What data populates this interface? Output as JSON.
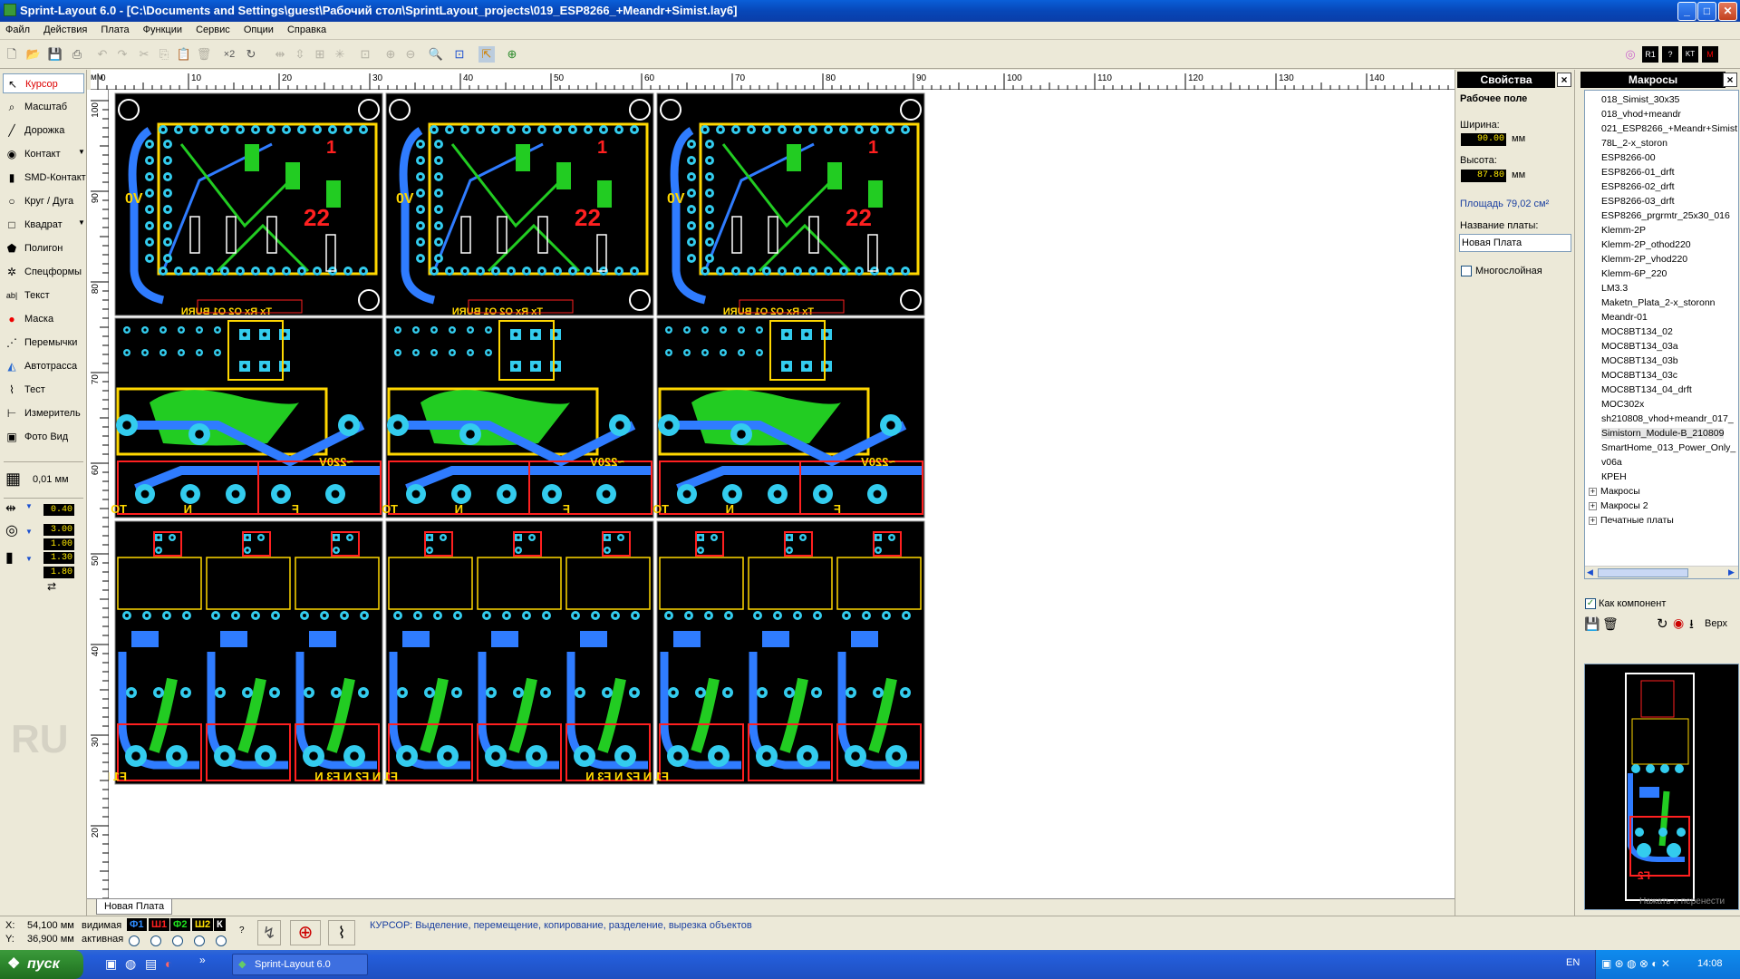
{
  "window": {
    "title": "Sprint-Layout 6.0 - [C:\\Documents and Settings\\guest\\Рабочий стол\\SprintLayout_projects\\019_ESP8266_+Meandr+Simist.lay6]",
    "minimize": "_",
    "maximize": "□",
    "close": "✕"
  },
  "menu": [
    "Файл",
    "Действия",
    "Плата",
    "Функции",
    "Сервис",
    "Опции",
    "Справка"
  ],
  "tools": [
    {
      "label": "Курсор",
      "icon": "cursor-icon",
      "glyph": "↖"
    },
    {
      "label": "Масштаб",
      "icon": "zoom-icon",
      "glyph": "⌕"
    },
    {
      "label": "Дорожка",
      "icon": "track-icon",
      "glyph": "╱"
    },
    {
      "label": "Контакт",
      "icon": "pad-icon",
      "glyph": "◉"
    },
    {
      "label": "SMD-Контакт",
      "icon": "smd-pad-icon",
      "glyph": "▮"
    },
    {
      "label": "Круг / Дуга",
      "icon": "circle-icon",
      "glyph": "○"
    },
    {
      "label": "Квадрат",
      "icon": "square-icon",
      "glyph": "□"
    },
    {
      "label": "Полигон",
      "icon": "polygon-icon",
      "glyph": "⬟"
    },
    {
      "label": "Спецформы",
      "icon": "special-forms-icon",
      "glyph": "✲"
    },
    {
      "label": "Текст",
      "icon": "text-icon",
      "glyph": "ab|"
    },
    {
      "label": "Маска",
      "icon": "mask-icon",
      "glyph": "●"
    },
    {
      "label": "Перемычки",
      "icon": "jumper-icon",
      "glyph": "⋰"
    },
    {
      "label": "Автотрасса",
      "icon": "autoroute-icon",
      "glyph": "◭"
    },
    {
      "label": "Тест",
      "icon": "test-icon",
      "glyph": "⌇"
    },
    {
      "label": "Измеритель",
      "icon": "measure-icon",
      "glyph": "⊢"
    },
    {
      "label": "Фото Вид",
      "icon": "photo-view-icon",
      "glyph": "▣"
    }
  ],
  "grid_label": "0,01 мм",
  "track_widths": {
    "track": "0.40",
    "pad_outer": "3.00",
    "pad_inner": "1.00",
    "smd_w": "1.30",
    "smd_h": "1.80"
  },
  "lang_watermark": "RU",
  "ruler_top": [
    "0",
    "10",
    "20",
    "30",
    "40",
    "50",
    "60",
    "70",
    "80",
    "90",
    "100",
    "110",
    "120",
    "130",
    "140"
  ],
  "ruler_units": "мм",
  "ruler_left": [
    "100",
    "90",
    "80",
    "70",
    "60",
    "50",
    "40",
    "30",
    "20"
  ],
  "board_tab": "Новая Плата",
  "properties": {
    "header": "Свойства",
    "section": "Рабочее поле",
    "width_label": "Ширина:",
    "width_value": "90.00",
    "height_label": "Высота:",
    "height_value": "87.80",
    "unit": "мм",
    "area": "Площадь 79,02 см²",
    "name_label": "Название платы:",
    "name_value": "Новая Плата",
    "multilayer": "Многослойная"
  },
  "macros": {
    "header": "Макросы",
    "items": [
      "018_Simist_30x35",
      "018_vhod+meandr",
      "021_ESP8266_+Meandr+Simist",
      "78L_2-x_storon",
      "ESP8266-00",
      "ESP8266-01_drft",
      "ESP8266-02_drft",
      "ESP8266-03_drft",
      "ESP8266_prgrmtr_25x30_016",
      "Klemm-2P",
      "Klemm-2P_othod220",
      "Klemm-2P_vhod220",
      "Klemm-6P_220",
      "LM3.3",
      "Maketn_Plata_2-x_storonn",
      "Meandr-01",
      "MOC8BT134_02",
      "MOC8BT134_03a",
      "MOC8BT134_03b",
      "MOC8BT134_03c",
      "MOC8BT134_04_drft",
      "MOC302x",
      "sh210808_vhod+meandr_017_",
      "Simistorn_Module-B_210809",
      "SmartHome_013_Power_Only_",
      "v06a",
      "КРЕН"
    ],
    "folders": [
      "Макросы",
      "Макросы 2",
      "Печатные платы"
    ],
    "as_component": "Как компонент",
    "top_label": "Верх",
    "preview_label": "F2",
    "preview_hint": "Нажать и перенести"
  },
  "status": {
    "x_label": "X:",
    "x_value": "54,100 мм",
    "y_label": "Y:",
    "y_value": "36,900 мм",
    "visible": "видимая",
    "active": "активная",
    "layers": [
      {
        "name": "Ф1",
        "color": "#2f8cff"
      },
      {
        "name": "Ш1",
        "color": "#ff2020"
      },
      {
        "name": "Ф2",
        "color": "#20e020"
      },
      {
        "name": "Ш2",
        "color": "#ffe000"
      },
      {
        "name": "К",
        "color": "#ffffff"
      }
    ],
    "help": "?",
    "hint": "КУРСОР: Выделение, перемещение, копирование, разделение, вырезка объектов"
  },
  "taskbar": {
    "start": "пуск",
    "app": "Sprint-Layout 6.0",
    "lang": "EN",
    "time": "14:08"
  },
  "colors": {
    "copper_top": "#2f7cff",
    "pads": "#33ccee",
    "copper_bottom": "#22cc22",
    "silk_top": "#ffd700",
    "silk_bottom": "#ff2020"
  }
}
